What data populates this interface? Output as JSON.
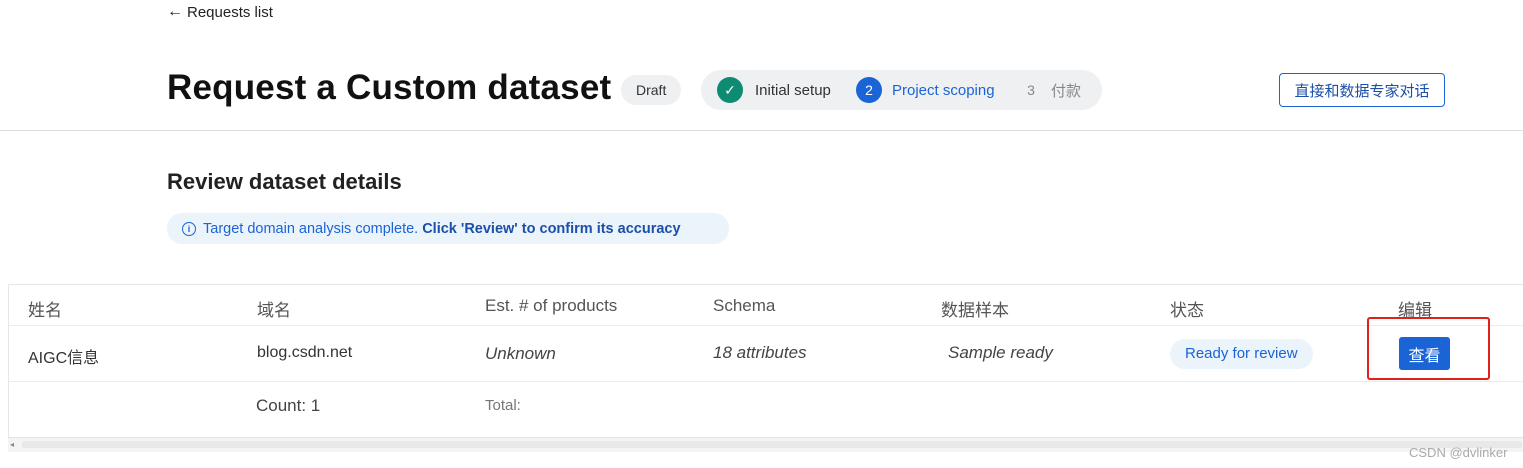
{
  "back_link": {
    "icon": "arrow-left-icon",
    "arrow": "←",
    "label": "Requests list"
  },
  "header": {
    "title": "Request a Custom dataset",
    "badge": "Draft",
    "steps": [
      {
        "marker": "✓",
        "label": "Initial setup",
        "state": "complete"
      },
      {
        "marker": "2",
        "label": "Project scoping",
        "state": "active"
      },
      {
        "marker": "3",
        "label": "付款",
        "state": "pending"
      }
    ],
    "expert_button": "直接和数据专家对话"
  },
  "section": {
    "title": "Review dataset details",
    "banner_icon": "i",
    "banner_text": "Target domain analysis complete.",
    "banner_strong": "Click 'Review' to confirm its accuracy"
  },
  "table": {
    "columns": [
      "姓名",
      "域名",
      "Est. # of products",
      "Schema",
      "数据样本",
      "状态",
      "编辑"
    ],
    "row": {
      "name": "AIGC信息",
      "domain": "blog.csdn.net",
      "products": "Unknown",
      "schema": "18 attributes",
      "sample": "Sample ready",
      "status": "Ready for review",
      "edit_button": "查看"
    },
    "footer": {
      "count": "Count: 1",
      "total": "Total:"
    }
  },
  "scrollbar": {
    "left_arrow": "◂"
  },
  "watermark": "CSDN @dvlinker",
  "colors": {
    "accent": "#1b64d6",
    "success": "#0f8a73",
    "highlight": "#e0201a"
  }
}
